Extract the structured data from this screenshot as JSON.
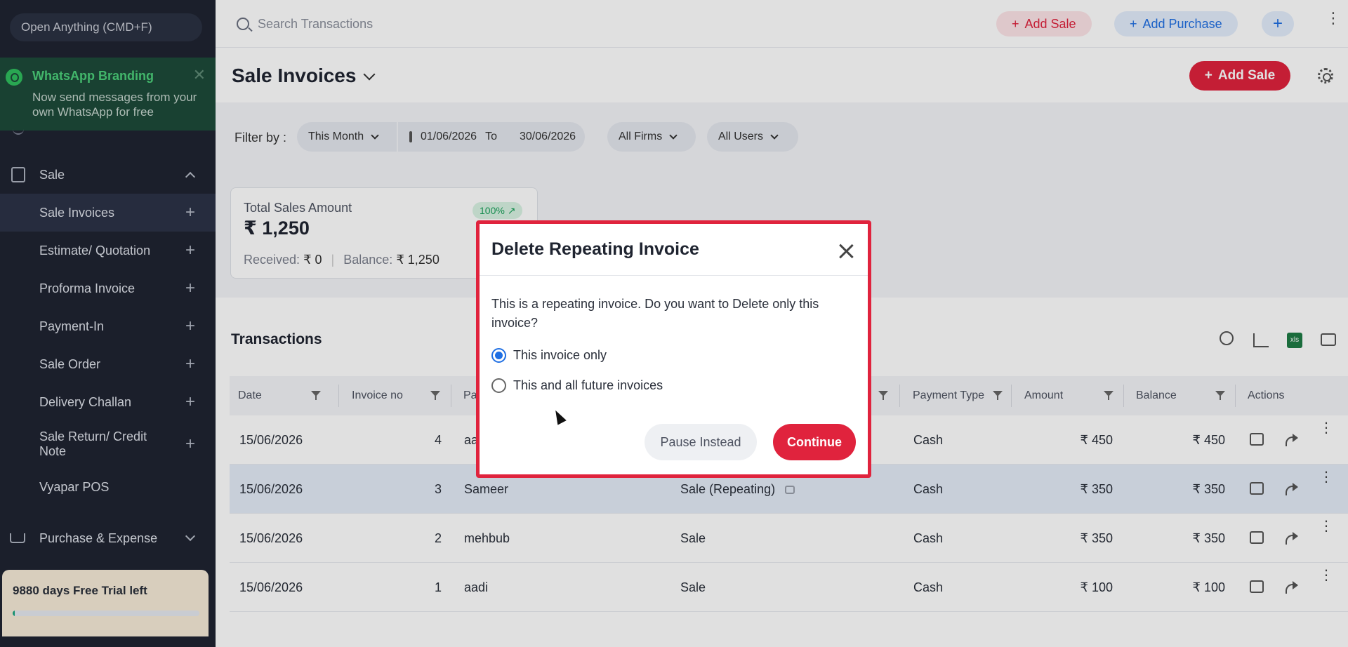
{
  "sidebar": {
    "open_anything": "Open Anything (CMD+F)",
    "whatsapp": {
      "title": "WhatsApp Branding",
      "text": "Now send messages from your own WhatsApp for free",
      "close": "✕"
    },
    "sale_section": "Sale",
    "items": [
      {
        "label": "Sale Invoices",
        "plus": "+"
      },
      {
        "label": "Estimate/ Quotation",
        "plus": "+"
      },
      {
        "label": "Proforma Invoice",
        "plus": "+"
      },
      {
        "label": "Payment-In",
        "plus": "+"
      },
      {
        "label": "Sale Order",
        "plus": "+"
      },
      {
        "label": "Delivery Challan",
        "plus": "+"
      },
      {
        "label": "Sale Return/ Credit Note",
        "plus": "+"
      },
      {
        "label": "Vyapar POS",
        "plus": ""
      }
    ],
    "purchase_section": "Purchase & Expense",
    "trial_text": "9880 days Free Trial left",
    "trial_progress": 0.01
  },
  "topbar": {
    "search_placeholder": "Search Transactions",
    "add_sale": "Add Sale",
    "add_purchase": "Add Purchase",
    "plus": "+",
    "more": "⋮"
  },
  "header": {
    "title": "Sale Invoices",
    "add_sale": "Add Sale"
  },
  "filters": {
    "label": "Filter by :",
    "period": "This Month",
    "date_from": "01/06/2026",
    "date_to_label": "To",
    "date_to": "30/06/2026",
    "firms": "All Firms",
    "users": "All Users"
  },
  "summary": {
    "label": "Total Sales Amount",
    "value": "₹ 1,250",
    "badge": "100% ↗",
    "received_label": "Received:",
    "received_value": "₹ 0",
    "balance_label": "Balance:",
    "balance_value": "₹ 1,250"
  },
  "transactions": {
    "title": "Transactions",
    "xls": "xls",
    "columns": [
      "Date",
      "Invoice no",
      "Pa",
      "Payment Type",
      "Amount",
      "Balance",
      "Actions"
    ],
    "rows": [
      {
        "date": "15/06/2026",
        "invoice": "4",
        "party": "aa",
        "txn_type": "",
        "payment": "Cash",
        "amount": "₹ 450",
        "balance": "₹ 450"
      },
      {
        "date": "15/06/2026",
        "invoice": "3",
        "party": "Sameer",
        "txn_type": "Sale (Repeating)",
        "payment": "Cash",
        "amount": "₹ 350",
        "balance": "₹ 350"
      },
      {
        "date": "15/06/2026",
        "invoice": "2",
        "party": "mehbub",
        "txn_type": "Sale",
        "payment": "Cash",
        "amount": "₹ 350",
        "balance": "₹ 350"
      },
      {
        "date": "15/06/2026",
        "invoice": "1",
        "party": "aadi",
        "txn_type": "Sale",
        "payment": "Cash",
        "amount": "₹ 100",
        "balance": "₹ 100"
      }
    ]
  },
  "modal": {
    "title": "Delete Repeating Invoice",
    "message": "This is a repeating invoice. Do you want to Delete only this invoice?",
    "option_1": "This invoice only",
    "option_2": "This and all future invoices",
    "selected_option": 1,
    "pause_button": "Pause Instead",
    "continue_button": "Continue"
  },
  "colors": {
    "accent_red": "#e0233d",
    "accent_blue": "#1f6fe3",
    "sidebar_bg": "#1f2432",
    "whatsapp_green": "#4cd07a"
  }
}
